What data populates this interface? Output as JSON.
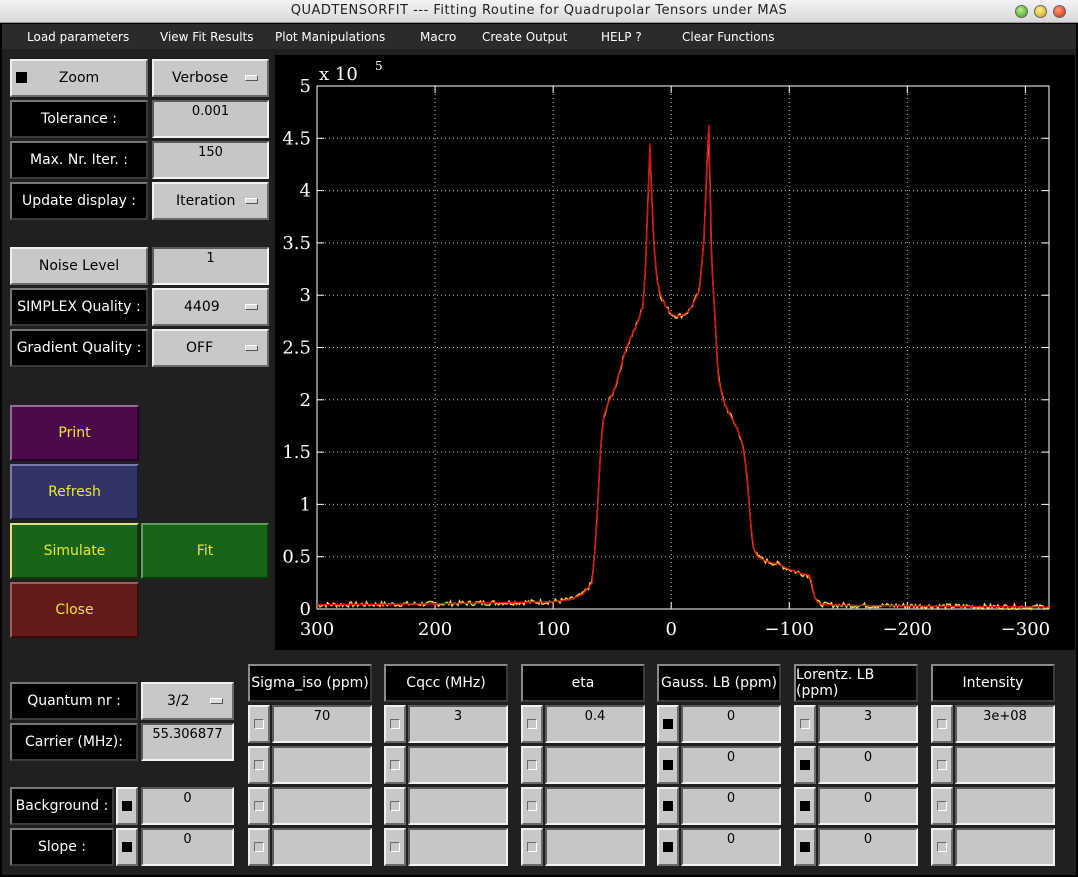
{
  "window": {
    "title": "QUADTENSORFIT --- Fitting Routine for Quadrupolar Tensors under MAS"
  },
  "menu": [
    {
      "label": "Load parameters"
    },
    {
      "label": "View Fit Results"
    },
    {
      "label": "Plot Manipulations"
    },
    {
      "label": "Macro"
    },
    {
      "label": "Create Output"
    },
    {
      "label": "HELP ?"
    },
    {
      "label": "Clear Functions"
    }
  ],
  "controls": {
    "zoom_label": "Zoom",
    "verbose_label": "Verbose",
    "tolerance_label": "Tolerance :",
    "tolerance_value": "0.001",
    "maxiter_label": "Max. Nr. Iter. :",
    "maxiter_value": "150",
    "update_label": "Update display :",
    "update_value": "Iteration",
    "noise_label": "Noise Level",
    "noise_value": "1",
    "simplex_label": "SIMPLEX Quality :",
    "simplex_value": "4409",
    "gradient_label": "Gradient Quality :",
    "gradient_value": "OFF"
  },
  "actions": {
    "print": "Print",
    "refresh": "Refresh",
    "simulate": "Simulate",
    "fit": "Fit",
    "close": "Close"
  },
  "bottom_left": {
    "quantum_label": "Quantum nr :",
    "quantum_value": "3/2",
    "carrier_label": "Carrier (MHz):",
    "carrier_value": "55.306877",
    "background_label": "Background :",
    "background_value": "0",
    "slope_label": "Slope :",
    "slope_value": "0"
  },
  "params": {
    "columns": [
      {
        "header": "Sigma_iso (ppm)",
        "values": [
          "70",
          "",
          "",
          ""
        ],
        "fixed": [
          false,
          false,
          false,
          false
        ]
      },
      {
        "header": "Cqcc (MHz)",
        "values": [
          "3",
          "",
          "",
          ""
        ],
        "fixed": [
          false,
          false,
          false,
          false
        ]
      },
      {
        "header": "eta",
        "values": [
          "0.4",
          "",
          "",
          ""
        ],
        "fixed": [
          false,
          false,
          false,
          false
        ]
      },
      {
        "header": "Gauss. LB (ppm)",
        "values": [
          "0",
          "0",
          "0",
          "0"
        ],
        "fixed": [
          true,
          true,
          true,
          true
        ]
      },
      {
        "header": "Lorentz. LB (ppm)",
        "values": [
          "3",
          "0",
          "0",
          "0"
        ],
        "fixed": [
          false,
          true,
          true,
          true
        ]
      },
      {
        "header": "Intensity",
        "values": [
          "3e+08",
          "",
          "",
          ""
        ],
        "fixed": [
          false,
          false,
          false,
          false
        ]
      }
    ]
  },
  "colors": {
    "background": "#000000",
    "experimental": "#ffd040",
    "fit": "#dd1010",
    "print_btn": "#4c0a4c",
    "refresh_btn": "#333366",
    "simulate_btn": "#1a641a",
    "fit_btn": "#1a641a",
    "close_btn": "#641a1a"
  },
  "chart_data": {
    "type": "line",
    "title": "",
    "xlabel": "",
    "ylabel": "",
    "y_exponent_label": "x 10",
    "y_exponent_power": "5",
    "xlim": [
      300,
      -320
    ],
    "ylim": [
      0,
      500000
    ],
    "x_ticks": [
      300,
      200,
      100,
      0,
      -100,
      -200,
      -300
    ],
    "x_tick_labels": [
      "300",
      "200",
      "100",
      "0",
      "−100",
      "−200",
      "−300"
    ],
    "y_ticks": [
      0,
      50000,
      100000,
      150000,
      200000,
      250000,
      300000,
      350000,
      400000,
      450000,
      500000
    ],
    "y_tick_labels": [
      "0",
      "0.5",
      "1",
      "1.5",
      "2",
      "2.5",
      "3",
      "3.5",
      "4",
      "4.5",
      "5"
    ],
    "grid": true,
    "series": [
      {
        "x": [
          300,
          200,
          100,
          85,
          75,
          67,
          63,
          60,
          57,
          53,
          48,
          43,
          38,
          32,
          28,
          24,
          22,
          20,
          18,
          16,
          14,
          12,
          9,
          5,
          0,
          -5,
          -10,
          -15,
          -20,
          -24,
          -26,
          -28,
          -30,
          -32,
          -34,
          -36,
          -38,
          -40,
          -44,
          -50,
          -55,
          -60,
          -64,
          -66,
          -68,
          -70,
          -73,
          -80,
          -90,
          -100,
          -110,
          -115,
          -118,
          -120,
          -122,
          -124,
          -130,
          -150,
          -200,
          -250,
          -300,
          -320
        ],
        "y": [
          4000,
          5000,
          7000,
          9000,
          14000,
          25000,
          80000,
          150000,
          185000,
          198000,
          210000,
          230000,
          250000,
          265000,
          275000,
          290000,
          320000,
          380000,
          445000,
          380000,
          340000,
          315000,
          300000,
          290000,
          282000,
          280000,
          281000,
          285000,
          295000,
          305000,
          330000,
          360000,
          420000,
          463000,
          340000,
          300000,
          260000,
          220000,
          200000,
          185000,
          175000,
          160000,
          130000,
          100000,
          75000,
          58000,
          50000,
          46000,
          43000,
          38000,
          34000,
          33000,
          30000,
          20000,
          10000,
          6000,
          4000,
          3500,
          3000,
          2500,
          2000,
          2000
        ]
      }
    ]
  }
}
